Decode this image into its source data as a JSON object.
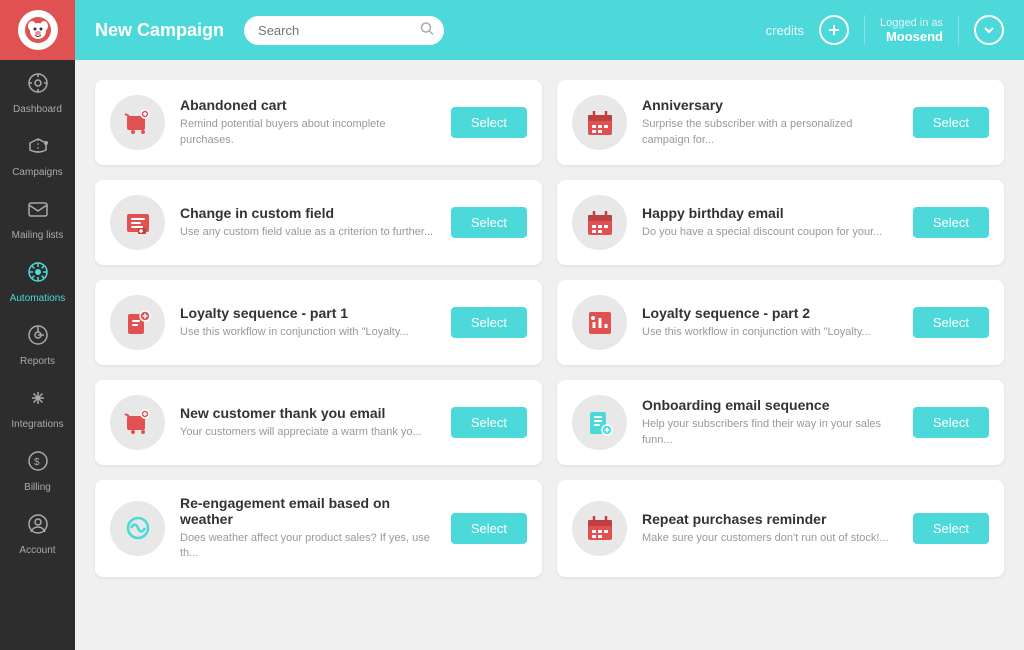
{
  "sidebar": {
    "logo_emoji": "🐶",
    "items": [
      {
        "id": "dashboard",
        "label": "Dashboard",
        "icon": "⊙"
      },
      {
        "id": "campaigns",
        "label": "Campaigns",
        "icon": "📣"
      },
      {
        "id": "mailing-lists",
        "label": "Mailing lists",
        "icon": "✉"
      },
      {
        "id": "automations",
        "label": "Automations",
        "icon": "⏱"
      },
      {
        "id": "reports",
        "label": "Reports",
        "icon": "⊙"
      },
      {
        "id": "integrations",
        "label": "Integrations",
        "icon": "✦"
      },
      {
        "id": "billing",
        "label": "Billing",
        "icon": "$"
      },
      {
        "id": "account",
        "label": "Account",
        "icon": "⚙"
      }
    ]
  },
  "topbar": {
    "title": "New Campaign",
    "search_placeholder": "Search",
    "credits_label": "credits",
    "logged_as_label": "Logged in as",
    "username": "Moosend",
    "add_icon": "+",
    "chevron_icon": "▾"
  },
  "campaigns": [
    {
      "id": "abandoned-cart",
      "title": "Abandoned cart",
      "desc": "Remind potential buyers about incomplete purchases.",
      "icon_type": "red",
      "icon_glyph": "🛒",
      "btn_label": "Select"
    },
    {
      "id": "anniversary",
      "title": "Anniversary",
      "desc": "Surprise the subscriber with a personalized campaign for...",
      "icon_type": "red",
      "icon_glyph": "📅",
      "btn_label": "Select"
    },
    {
      "id": "change-custom-field",
      "title": "Change in custom field",
      "desc": "Use any custom field value as a criterion to further...",
      "icon_type": "red",
      "icon_glyph": "📋",
      "btn_label": "Select"
    },
    {
      "id": "happy-birthday",
      "title": "Happy birthday email",
      "desc": "Do you have a special discount coupon for your...",
      "icon_type": "red",
      "icon_glyph": "📅",
      "btn_label": "Select"
    },
    {
      "id": "loyalty-1",
      "title": "Loyalty sequence - part 1",
      "desc": "Use this workflow in conjunction with \"Loyalty...",
      "icon_type": "red",
      "icon_glyph": "🏷",
      "btn_label": "Select"
    },
    {
      "id": "loyalty-2",
      "title": "Loyalty sequence - part 2",
      "desc": "Use this workflow in conjunction with \"Loyalty...",
      "icon_type": "red",
      "icon_glyph": "📊",
      "btn_label": "Select"
    },
    {
      "id": "new-customer",
      "title": "New customer thank you email",
      "desc": "Your customers will appreciate a warm thank yo...",
      "icon_type": "red",
      "icon_glyph": "🏷",
      "btn_label": "Select"
    },
    {
      "id": "onboarding",
      "title": "Onboarding email sequence",
      "desc": "Help your subscribers find their way in your sales funn...",
      "icon_type": "teal",
      "icon_glyph": "🏷",
      "btn_label": "Select"
    },
    {
      "id": "re-engagement",
      "title": "Re-engagement email based on weather",
      "desc": "Does weather affect your product sales? If yes, use th...",
      "icon_type": "teal",
      "icon_glyph": "🔗",
      "btn_label": "Select"
    },
    {
      "id": "repeat-purchases",
      "title": "Repeat purchases reminder",
      "desc": "Make sure your customers don't run out of stock!...",
      "icon_type": "red",
      "icon_glyph": "📅",
      "btn_label": "Select"
    }
  ]
}
